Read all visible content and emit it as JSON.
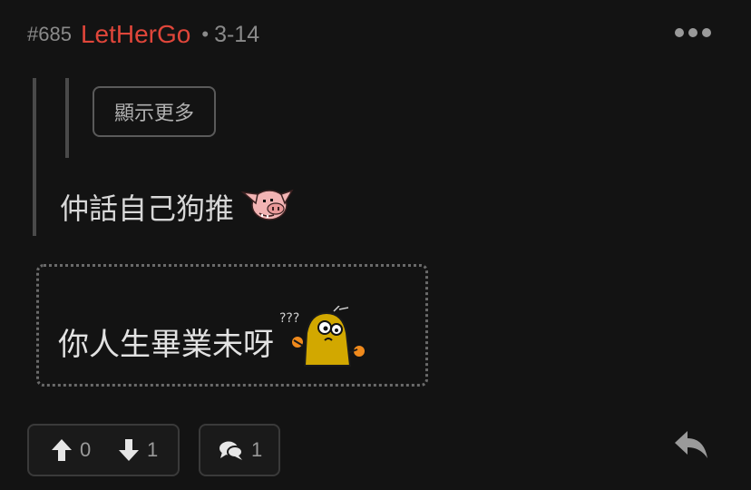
{
  "post": {
    "floor": "#685",
    "username": "LetHerGo",
    "separator": "•",
    "date": "3-14"
  },
  "quote": {
    "show_more_label": "顯示更多",
    "text": "仲話自己狗推"
  },
  "reply": {
    "text": "你人生畢業未呀"
  },
  "actions": {
    "upvotes": "0",
    "downvotes": "1",
    "comments": "1"
  },
  "colors": {
    "username": "#e0463a",
    "background": "#131313"
  }
}
